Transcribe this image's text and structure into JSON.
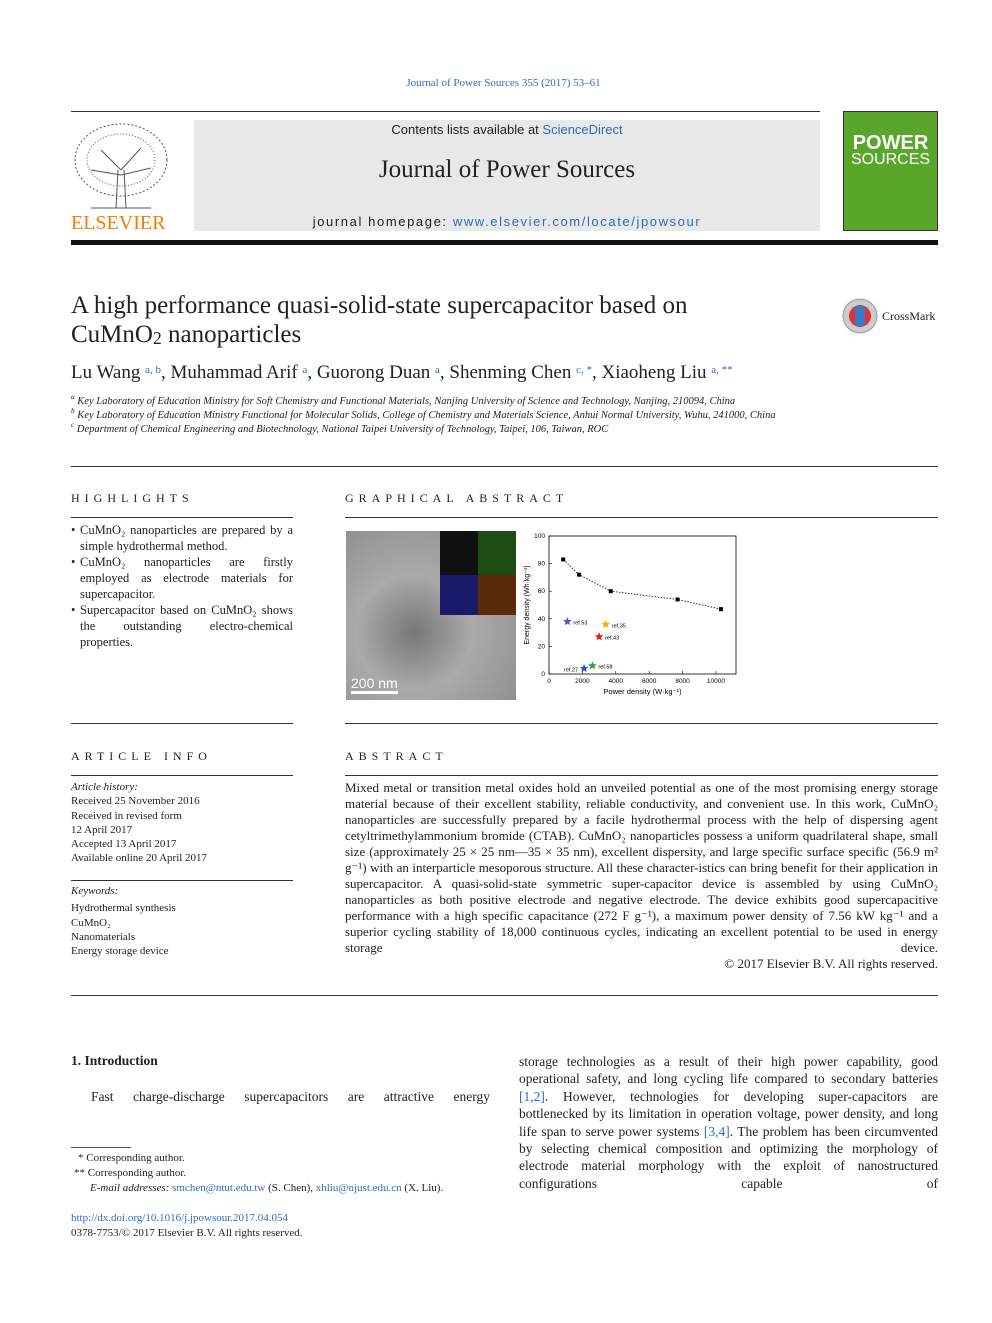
{
  "citation": "Journal of Power Sources 355 (2017) 53–61",
  "masthead": {
    "contents_prefix": "Contents lists available at ",
    "contents_link": "ScienceDirect",
    "journal": "Journal of Power Sources",
    "homepage_prefix": "journal homepage: ",
    "homepage_link": "www.elsevier.com/locate/jpowsour",
    "publisher": "ELSEVIER",
    "cover_title_1": "POWER",
    "cover_title_2": "SOURCES",
    "cover_color": "#5aa62a",
    "publisher_color": "#f07f00"
  },
  "crossmark": "CrossMark",
  "title_line1": "A high performance quasi-solid-state supercapacitor based on",
  "title_line2_pre": "CuMnO",
  "title_line2_sub": "2",
  "title_line2_post": " nanoparticles",
  "authors": [
    {
      "name": "Lu Wang",
      "aff": "a, b"
    },
    {
      "name": "Muhammad Arif",
      "aff": "a"
    },
    {
      "name": "Guorong Duan",
      "aff": "a"
    },
    {
      "name": "Shenming Chen",
      "aff": "c, *"
    },
    {
      "name": "Xiaoheng Liu",
      "aff": "a, **"
    }
  ],
  "affiliations": [
    {
      "mark": "a",
      "text": "Key Laboratory of Education Ministry for Soft Chemistry and Functional Materials, Nanjing University of Science and Technology, Nanjing, 210094, China"
    },
    {
      "mark": "b",
      "text": "Key Laboratory of Education Ministry Functional for Molecular Solids, College of Chemistry and Materials Science, Anhui Normal University, Wuhu, 241000, China"
    },
    {
      "mark": "c",
      "text": "Department of Chemical Engineering and Biotechnology, National Taipei University of Technology, Taipei, 106, Taiwan, ROC"
    }
  ],
  "highlights": {
    "heading": "HIGHLIGHTS",
    "items": [
      "CuMnO₂ nanoparticles are prepared by a simple hydrothermal method.",
      "CuMnO₂ nanoparticles are firstly employed as electrode materials for supercapacitor.",
      "Supercapacitor based on CuMnO₂ shows the outstanding electro-chemical properties."
    ]
  },
  "graphical_abstract": {
    "heading": "GRAPHICAL ABSTRACT",
    "scale_bar": "200 nm"
  },
  "chart_data": {
    "type": "scatter",
    "xlabel": "Power density (W·kg⁻¹)",
    "ylabel": "Energy density (Wh·kg⁻¹)",
    "xlim": [
      0,
      11200
    ],
    "ylim": [
      0,
      100
    ],
    "xticks": [
      0,
      2000,
      4000,
      6000,
      8000,
      10000
    ],
    "yticks": [
      0,
      20,
      40,
      60,
      80,
      100
    ],
    "series": [
      {
        "marker": "square",
        "line": "dotted",
        "color": "#000000",
        "x": [
          850,
          1800,
          3700,
          7700,
          10300
        ],
        "y": [
          83,
          72,
          60,
          54,
          47
        ]
      }
    ],
    "references": [
      {
        "name": "ref.53",
        "x": 1100,
        "y": 38,
        "color": "#5050d0"
      },
      {
        "name": "ref.35",
        "x": 3400,
        "y": 36,
        "color": "#e8b400"
      },
      {
        "name": "ref.43",
        "x": 3000,
        "y": 27,
        "color": "#e02020"
      },
      {
        "name": "ref.27",
        "x": 2100,
        "y": 4,
        "color": "#3050c0"
      },
      {
        "name": "ref.58",
        "x": 2600,
        "y": 6,
        "color": "#30a030"
      }
    ]
  },
  "article_info": {
    "heading": "ARTICLE INFO",
    "history_label": "Article history:",
    "history": [
      "Received 25 November 2016",
      "Received in revised form",
      "12 April 2017",
      "Accepted 13 April 2017",
      "Available online 20 April 2017"
    ],
    "keywords_label": "Keywords:",
    "keywords": [
      "Hydrothermal synthesis",
      "CuMnO₂",
      "Nanomaterials",
      "Energy storage device"
    ]
  },
  "abstract": {
    "heading": "ABSTRACT",
    "text": "Mixed metal or transition metal oxides hold an unveiled potential as one of the most promising energy storage material because of their excellent stability, reliable conductivity, and convenient use. In this work, CuMnO₂ nanoparticles are successfully prepared by a facile hydrothermal process with the help of dispersing agent cetyltrimethylammonium bromide (CTAB). CuMnO₂ nanoparticles possess a uniform quadrilateral shape, small size (approximately 25 × 25 nm—35 × 35 nm), excellent dispersity, and large specific surface specific (56.9 m² g⁻¹) with an interparticle mesoporous structure. All these character-istics can bring benefit for their application in supercapacitor. A quasi-solid-state symmetric super-capacitor device is assembled by using CuMnO₂ nanoparticles as both positive electrode and negative electrode. The device exhibits good supercapacitive performance with a high specific capacitance (272 F g⁻¹), a maximum power density of 7.56 kW kg⁻¹ and a superior cycling stability of 18,000 continuous cycles, indicating an excellent potential to be used in energy storage device.",
    "copyright": "© 2017 Elsevier B.V. All rights reserved."
  },
  "intro": {
    "heading": "1.  Introduction",
    "left_text": "Fast charge-discharge supercapacitors are attractive energy",
    "right_p1": "storage technologies as a result of their high power capability, good operational safety, and long cycling life compared to secondary batteries ",
    "ref1": "[1,2]",
    "right_p2": ". However, technologies for developing super-capacitors are bottlenecked by its limitation in operation voltage, power density, and long life span to serve power systems ",
    "ref2": "[3,4]",
    "right_p3": ". The problem has been circumvented by selecting chemical composition and optimizing the morphology of electrode material morphology with the exploit of nanostructured configurations capable of"
  },
  "footnotes": {
    "star1": "*  Corresponding author.",
    "star2": "**  Corresponding author.",
    "email_label": "E-mail addresses: ",
    "email1": "smchen@ntut.edu.tw",
    "email1_who": " (S. Chen), ",
    "email2": "xhliu@njust.edu.cn",
    "email2_who": " (X. Liu)."
  },
  "doi": "http://dx.doi.org/10.1016/j.jpowsour.2017.04.054",
  "issn": "0378-7753/© 2017 Elsevier B.V. All rights reserved."
}
